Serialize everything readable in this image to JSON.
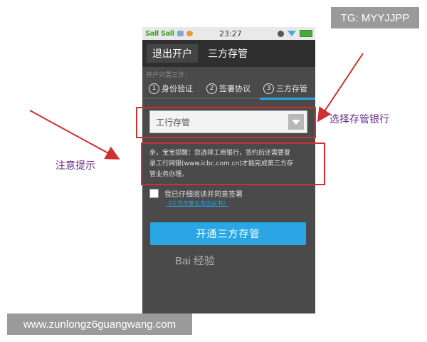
{
  "watermarks": {
    "tg": "TG: MYYJJPP",
    "url": "www.zunlongz6guangwang.com",
    "baidu": "Bai 经验"
  },
  "status_bar": {
    "signal1": "Sall",
    "signal2": "Sall",
    "time": "23:27"
  },
  "tabs": [
    {
      "label": "退出开户",
      "active": true
    },
    {
      "label": "三方存管",
      "active": false
    }
  ],
  "steps": {
    "heading": "开户只需三步：",
    "items": [
      {
        "num": "1",
        "label": "身份验证"
      },
      {
        "num": "2",
        "label": "签署协议"
      },
      {
        "num": "3",
        "label": "三方存管"
      }
    ],
    "active_step": 3
  },
  "bank_select": {
    "value": "工行存管"
  },
  "notice": {
    "line1": "亲，宝宝提醒：您选择工商银行，签约后还需要登",
    "line2": "录工行网银(www.icbc.com.cn)才能完成第三方存",
    "line3": "管业务办理。"
  },
  "agreement": {
    "checkbox_label": "我已仔细阅读并同意签署",
    "link_text": "《三方存管业务协议书》",
    "checked": false
  },
  "open_button": {
    "label": "开通三方存管"
  },
  "annotations": {
    "left": "注意提示",
    "right": "选择存管银行"
  },
  "colors": {
    "accent": "#2aa6e4",
    "annotation_red": "#d03030",
    "annotation_text": "#6a2c8a"
  }
}
